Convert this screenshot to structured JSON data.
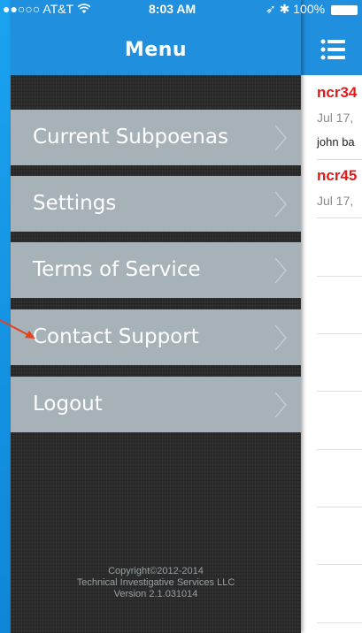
{
  "status_bar": {
    "carrier": "●●○○○ AT&T",
    "wifi_icon": "wifi-icon",
    "time": "8:03 AM",
    "right": "➶ ✱ 100%",
    "battery_icon": "battery-icon"
  },
  "menu": {
    "title": "Menu",
    "items": [
      {
        "label": "Current Subpoenas"
      },
      {
        "label": "Settings"
      },
      {
        "label": "Terms of Service"
      },
      {
        "label": "Contact Support"
      },
      {
        "label": "Logout"
      }
    ],
    "footer": {
      "copyright": "Copyright©2012-2014",
      "company": "Technical Investigative Services LLC",
      "version": "Version 2.1.031014"
    }
  },
  "content": {
    "rows": [
      {
        "title": "ncr34",
        "date": "Jul 17,",
        "subtitle": "john ba"
      },
      {
        "title": "ncr45",
        "date": "Jul 17,"
      }
    ]
  },
  "colors": {
    "header_blue": "#1f8fde",
    "menu_item_bg": "#a7b1b8",
    "row_title_red": "#e01b1b",
    "annotation_arrow": "#e8401c"
  }
}
